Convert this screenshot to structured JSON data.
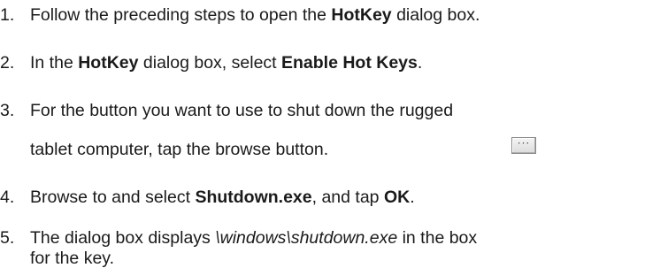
{
  "steps": [
    {
      "number": "1.",
      "pre": "Follow the preceding steps to open the ",
      "bold": "HotKey",
      "post": " dialog box."
    },
    {
      "number": "2.",
      "pre": "In the ",
      "bold1": "HotKey",
      "mid": " dialog box, select ",
      "bold2": "Enable Hot Keys",
      "post": "."
    },
    {
      "number": "3.",
      "line1": "For the button you want to use to shut down the rugged",
      "line2": "tablet computer, tap the browse button.",
      "button_glyph": "···"
    },
    {
      "number": "4.",
      "pre": "Browse to and select ",
      "bold1": "Shutdown.exe",
      "mid": ", and tap ",
      "bold2": "OK",
      "post": "."
    },
    {
      "number": "5.",
      "pre": "The dialog box displays ",
      "italic": "\\windows\\shutdown.exe",
      "post": " in the box",
      "line2": "for the key."
    }
  ]
}
